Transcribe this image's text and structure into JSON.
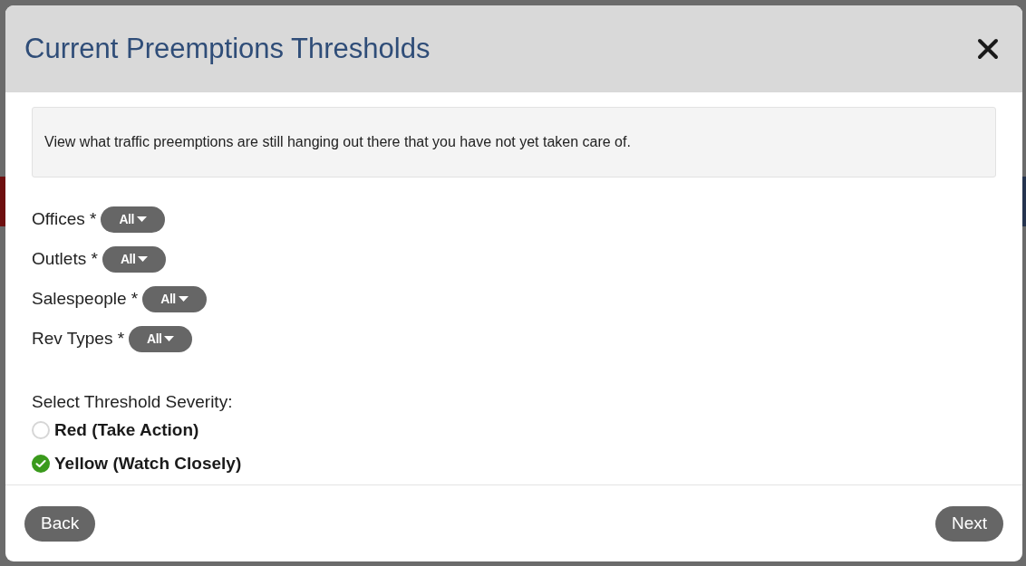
{
  "dialog": {
    "title": "Current Preemptions Thresholds",
    "description": "View what traffic preemptions are still hanging out there that you have not yet taken care of.",
    "filters": [
      {
        "label": "Offices *",
        "value": "All"
      },
      {
        "label": "Outlets *",
        "value": "All"
      },
      {
        "label": "Salespeople *",
        "value": "All"
      },
      {
        "label": "Rev Types *",
        "value": "All"
      }
    ],
    "severity": {
      "label": "Select Threshold Severity:",
      "options": [
        {
          "label": "Red (Take Action)",
          "selected": false
        },
        {
          "label": "Yellow (Watch Closely)",
          "selected": true
        }
      ]
    },
    "buttons": [
      {
        "label": "Back"
      },
      {
        "label": "Next"
      }
    ]
  }
}
